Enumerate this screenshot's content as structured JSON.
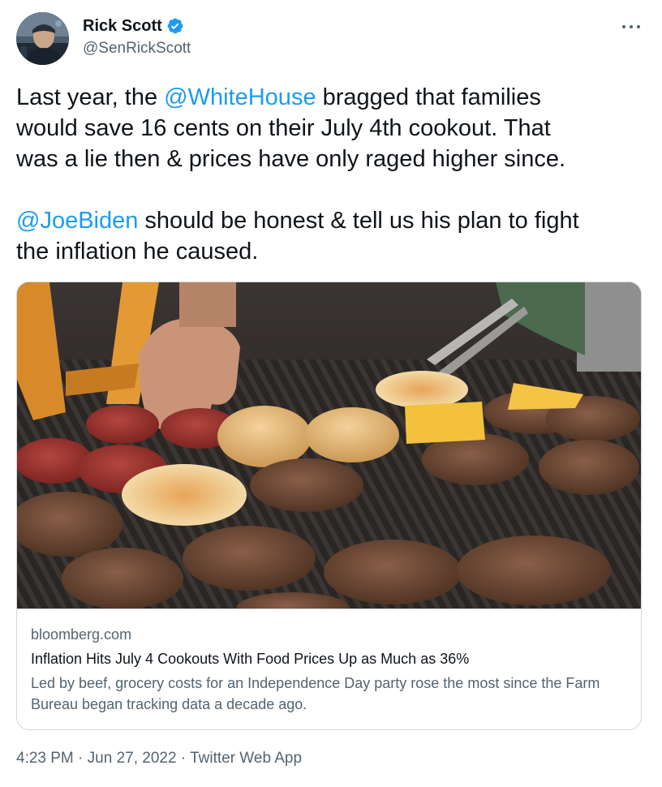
{
  "author": {
    "name": "Rick Scott",
    "handle": "@SenRickScott"
  },
  "icons": {
    "avatar": "profile-photo",
    "verified": "verified-badge-icon",
    "more": "more-options-icon"
  },
  "tweet": {
    "lines": [
      [
        "Last year, the ",
        "@WhiteHouse",
        " bragged that families"
      ],
      "would save 16 cents on their July 4th cookout. That",
      "was a lie then & prices have only raged higher since.",
      [
        "@JoeBiden",
        " should be honest & tell us his plan to fight"
      ],
      "the inflation he caused."
    ]
  },
  "card": {
    "domain": "bloomberg.com",
    "title": "Inflation Hits July 4 Cookouts With Food Prices Up as Much as 36%",
    "description": "Led by beef, grocery costs for an Independence Day party rose the most since the Farm Bureau began tracking data a decade ago.",
    "image": "burgers-on-grill-photo"
  },
  "meta": {
    "time": "4:23 PM",
    "sep1": " · ",
    "date": "Jun 27, 2022",
    "sep2": " · ",
    "source": "Twitter Web App"
  },
  "colors": {
    "link": "#1d9bf0",
    "text": "#0f1419",
    "secondary": "#536471",
    "border": "#cfd9de"
  }
}
